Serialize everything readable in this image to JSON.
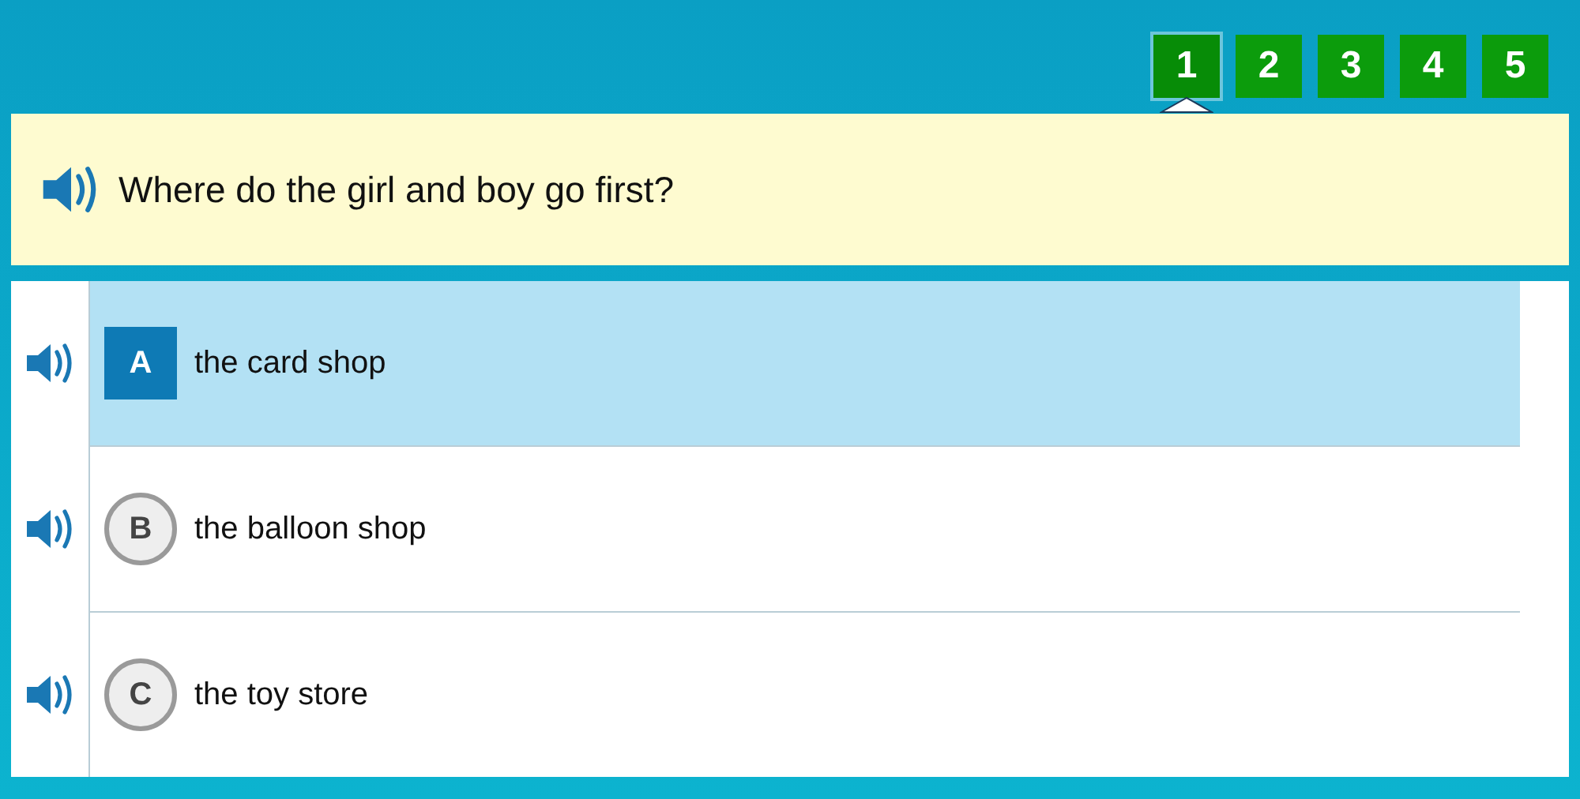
{
  "question_nav": [
    {
      "label": "1",
      "selected": true
    },
    {
      "label": "2",
      "selected": false
    },
    {
      "label": "3",
      "selected": false
    },
    {
      "label": "4",
      "selected": false
    },
    {
      "label": "5",
      "selected": false
    }
  ],
  "question": {
    "text": "Where do the girl and boy go first?"
  },
  "options": [
    {
      "letter": "A",
      "text": "the card shop",
      "selected": true
    },
    {
      "letter": "B",
      "text": "the balloon shop",
      "selected": false
    },
    {
      "letter": "C",
      "text": "the toy store",
      "selected": false
    }
  ]
}
